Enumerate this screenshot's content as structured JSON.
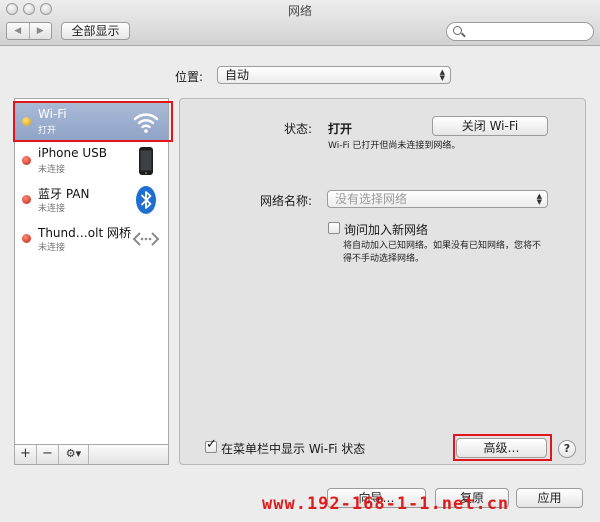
{
  "window": {
    "title": "网络"
  },
  "toolbar": {
    "show_all": "全部显示",
    "back_glyph": "◀",
    "forward_glyph": "▶",
    "search_placeholder": ""
  },
  "location": {
    "label": "位置:",
    "value": "自动"
  },
  "services": [
    {
      "name": "Wi-Fi",
      "status": "打开",
      "status_color": "#e8b21f",
      "icon": "wifi-icon",
      "selected": true
    },
    {
      "name": "iPhone USB",
      "status": "未连接",
      "status_color": "#cc2a1e",
      "icon": "iphone-icon",
      "selected": false
    },
    {
      "name": "蓝牙 PAN",
      "status": "未连接",
      "status_color": "#cc2a1e",
      "icon": "bluetooth-icon",
      "selected": false
    },
    {
      "name": "Thund…olt 网桥",
      "status": "未连接",
      "status_color": "#cc2a1e",
      "icon": "thunderbolt-bridge-icon",
      "selected": false
    }
  ],
  "sidebar_toolbar": {
    "add": "+",
    "remove": "−",
    "gear": "⚙▾"
  },
  "detail": {
    "status_label": "状态:",
    "status_value": "打开",
    "turn_off_button": "关闭 Wi-Fi",
    "status_note": "Wi-Fi 已打开但尚未连接到网络。",
    "network_name_label": "网络名称:",
    "network_name_placeholder": "没有选择网络",
    "ask_join_label": "询问加入新网络",
    "ask_join_checked": false,
    "ask_join_note_line1": "将自动加入已知网络。如果没有已知网络，您将不",
    "ask_join_note_line2": "得不手动选择网络。",
    "show_menubar_label": "在菜单栏中显示 Wi-Fi 状态",
    "show_menubar_checked": true,
    "advanced_button": "高级…",
    "help_button": "?"
  },
  "bottom_buttons": {
    "assistant": "向导…",
    "revert": "复原",
    "apply": "应用"
  },
  "watermark": "www.192-168-1-1.net.cn",
  "colors": {
    "highlight": "#e0161b",
    "selection": "#95a8c9",
    "watermark": "#dd1d1d"
  }
}
